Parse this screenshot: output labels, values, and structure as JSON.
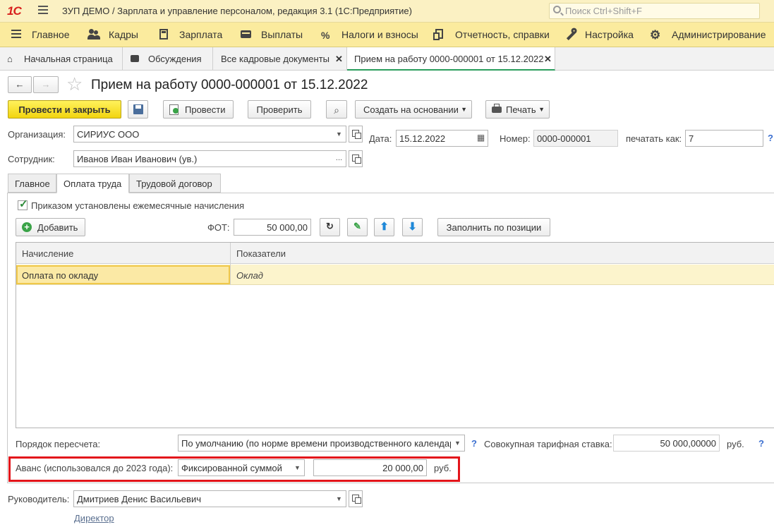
{
  "app": {
    "logo": "1С",
    "title": "ЗУП ДЕМО / Зарплата и управление персоналом, редакция 3.1  (1С:Предприятие)",
    "search_placeholder": "Поиск Ctrl+Shift+F"
  },
  "menu": [
    {
      "label": "Главное",
      "icon": "menu-icon"
    },
    {
      "label": "Кадры",
      "icon": "people-icon"
    },
    {
      "label": "Зарплата",
      "icon": "calculator-icon"
    },
    {
      "label": "Выплаты",
      "icon": "wallet-icon"
    },
    {
      "label": "Налоги и взносы",
      "icon": "percent-icon"
    },
    {
      "label": "Отчетность, справки",
      "icon": "reports-icon"
    },
    {
      "label": "Настройка",
      "icon": "wrench-icon"
    },
    {
      "label": "Администрирование",
      "icon": "gear-icon"
    }
  ],
  "window_tabs": [
    {
      "label": "Начальная страница",
      "icon": "home-icon"
    },
    {
      "label": "Обсуждения",
      "icon": "chat-icon"
    },
    {
      "label": "Все кадровые документы",
      "close": "✕"
    },
    {
      "label": "Прием на работу 0000-000001 от 15.12.2022",
      "close": "✕"
    }
  ],
  "document": {
    "title": "Прием на работу 0000-000001 от 15.12.2022"
  },
  "toolbar": {
    "post_close": "Провести и закрыть",
    "post": "Провести",
    "check": "Проверить",
    "create_based": "Создать на основании",
    "print": "Печать"
  },
  "header_fields": {
    "org_label": "Организация:",
    "org_value": "СИРИУС ООО",
    "date_label": "Дата:",
    "date_value": "15.12.2022",
    "number_label": "Номер:",
    "number_value": "0000-000001",
    "print_as_label": "печатать как:",
    "print_as_value": "7",
    "employee_label": "Сотрудник:",
    "employee_value": "Иванов Иван Иванович (ув.)",
    "dots": "...",
    "help": "?"
  },
  "form_tabs": [
    "Главное",
    "Оплата труда",
    "Трудовой договор"
  ],
  "payment": {
    "checkbox_label": "Приказом установлены ежемесячные начисления",
    "checkbox_checked": true,
    "add_button": "Добавить",
    "fot_label": "ФОТ:",
    "fot_value": "50 000,00",
    "fill_button": "Заполнить по позиции",
    "columns": [
      "Начисление",
      "Показатели"
    ],
    "rows": [
      {
        "accrual": "Оплата по окладу",
        "indicators": "Оклад"
      }
    ],
    "recalc_label": "Порядок пересчета:",
    "recalc_value": "По умолчанию (по норме времени производственного календаря)",
    "rate_label": "Совокупная тарифная ставка:",
    "rate_value": "50 000,00000",
    "rate_unit": "руб.",
    "advance_label": "Аванс (использовался до 2023 года):",
    "advance_method": "Фиксированной суммой",
    "advance_value": "20 000,00",
    "advance_unit": "руб."
  },
  "footer": {
    "manager_label": "Руководитель:",
    "manager_value": "Дмитриев Денис Васильевич",
    "position_link": "Директор"
  },
  "colors": {
    "accent_yellow": "#f2d40f",
    "highlight_red": "#e3151b",
    "active_tab_green": "#2a9d5c",
    "selected_row": "#fcf4cc"
  }
}
